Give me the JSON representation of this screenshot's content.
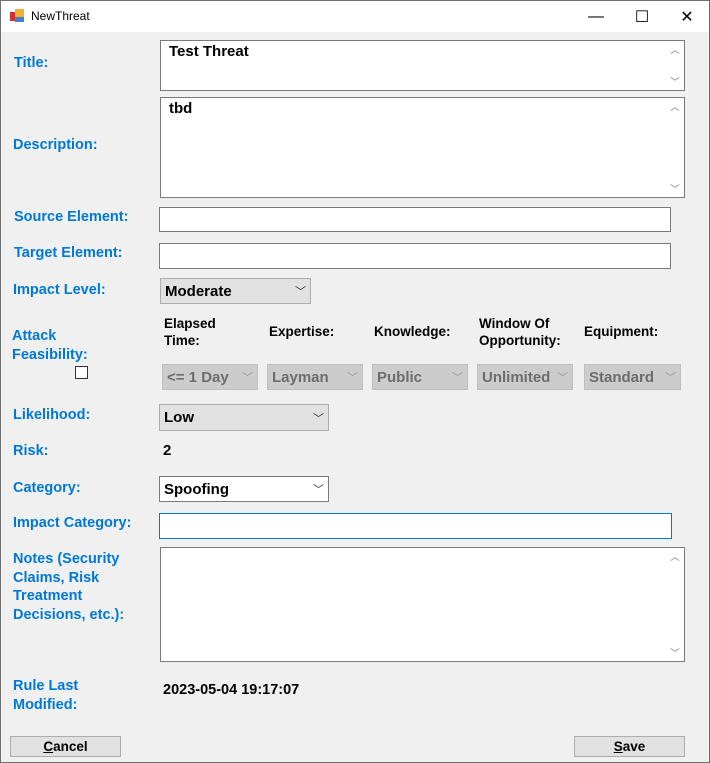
{
  "window": {
    "title": "NewThreat",
    "minimize": "—",
    "maximize": "☐",
    "close": "✕"
  },
  "form": {
    "title_label": "Title:",
    "title_value": "Test Threat",
    "description_label": "Description:",
    "description_value": "tbd",
    "source_label": "Source Element:",
    "source_value": "",
    "target_label": "Target Element:",
    "target_value": "",
    "impact_level_label": "Impact Level:",
    "impact_level_value": "Moderate",
    "attack_feasibility_label": "Attack Feasibility:",
    "attack_feasibility_checked": false,
    "feasibility": [
      {
        "label": "Elapsed Time:",
        "value": "<= 1 Day"
      },
      {
        "label": "Expertise:",
        "value": "Layman"
      },
      {
        "label": "Knowledge:",
        "value": "Public"
      },
      {
        "label": "Window Of Opportunity:",
        "value": "Unlimited"
      },
      {
        "label": "Equipment:",
        "value": "Standard"
      }
    ],
    "likelihood_label": "Likelihood:",
    "likelihood_value": "Low",
    "risk_label": "Risk:",
    "risk_value": "2",
    "category_label": "Category:",
    "category_value": "Spoofing",
    "impact_category_label": "Impact Category:",
    "impact_category_value": "",
    "notes_label": "Notes (Security Claims, Risk Treatment Decisions, etc.):",
    "notes_value": "",
    "rule_modified_label": "Rule Last Modified:",
    "rule_modified_value": "2023-05-04 19:17:07"
  },
  "buttons": {
    "cancel_first": "C",
    "cancel_rest": "ancel",
    "save_first": "S",
    "save_rest": "ave"
  },
  "colors": {
    "label": "#0078d7",
    "focus_border": "#0078d7"
  }
}
